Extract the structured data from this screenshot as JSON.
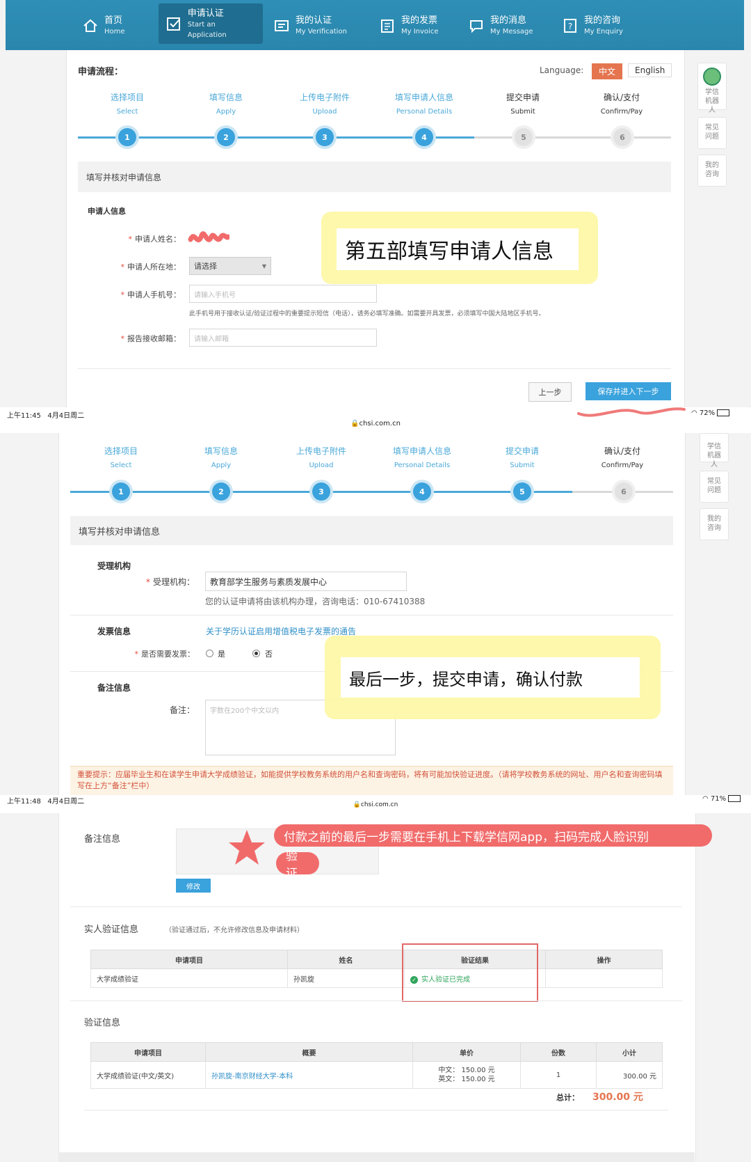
{
  "nav": [
    {
      "zh": "首页",
      "en": "Home",
      "icon": "home-icon"
    },
    {
      "zh": "申请认证",
      "en": "Start an Application",
      "icon": "checkbox-icon",
      "active": true
    },
    {
      "zh": "我的认证",
      "en": "My Verification",
      "icon": "verification-icon"
    },
    {
      "zh": "我的发票",
      "en": "My Invoice",
      "icon": "invoice-icon"
    },
    {
      "zh": "我的消息",
      "en": "My Message",
      "icon": "message-icon"
    },
    {
      "zh": "我的咨询",
      "en": "My Enquiry",
      "icon": "enquiry-icon"
    }
  ],
  "process": {
    "title": "申请流程：",
    "language_label": "Language:",
    "lang_zh": "中文",
    "lang_en": "English"
  },
  "steps": [
    {
      "zh": "选择项目",
      "en": "Select",
      "n": "1"
    },
    {
      "zh": "填写信息",
      "en": "Apply",
      "n": "2"
    },
    {
      "zh": "上传电子附件",
      "en": "Upload",
      "n": "3"
    },
    {
      "zh": "填写申请人信息",
      "en": "Personal Details",
      "n": "4"
    },
    {
      "zh": "提交申请",
      "en": "Submit",
      "n": "5"
    },
    {
      "zh": "确认/支付",
      "en": "Confirm/Pay",
      "n": "6"
    }
  ],
  "side": {
    "robot": "学信机器人",
    "faq": "常见问题",
    "enquiry": "我的咨询"
  },
  "panel1": {
    "section": "填写并核对申请信息",
    "applicant_title": "申请人信息",
    "name_label": "申请人姓名：",
    "location_label": "申请人所在地：",
    "location_value": "请选择",
    "phone_label": "申请人手机号：",
    "phone_placeholder": "请输入手机号",
    "phone_hint": "此手机号用于接收认证/验证过程中的重要提示短信（电话），请务必填写准确。如需要开具发票，必须填写中国大陆地区手机号。",
    "email_label": "报告接收邮箱：",
    "email_placeholder": "请输入邮箱",
    "prev_button": "上一步",
    "next_button": "保存并进入下一步",
    "note": "第五部填写申请人信息"
  },
  "status1": {
    "time": "上午11:45",
    "date": "4月4日周二",
    "url": "chsi.com.cn",
    "battery": "72%"
  },
  "panel2": {
    "section": "填写并核对申请信息",
    "agency_title": "受理机构",
    "agency_label": "受理机构：",
    "agency_value": "教育部学生服务与素质发展中心",
    "agency_hint": "您的认证申请将由该机构办理，咨询电话：010-67410388",
    "invoice_title": "发票信息",
    "invoice_link": "关于学历认证启用增值税电子发票的通告",
    "invoice_label": "是否需要发票：",
    "yes": "是",
    "no": "否",
    "remark_title": "备注信息",
    "remark_label": "备注：",
    "remark_placeholder": "字数在200个中文以内",
    "tip": "重要提示：应届毕业生和在读学生申请大学成绩验证，如能提供学校教务系统的用户名和查询密码，将有可能加快验证进度。（请将学校教务系统的网址、用户名和查询密码填写在上方“备注”栏中）",
    "note": "最后一步，提交申请，确认付款"
  },
  "status2": {
    "time": "上午11:48",
    "date": "4月4日周二",
    "url": "chsi.com.cn",
    "battery": "71%"
  },
  "panel3": {
    "remark_title": "备注信息",
    "modify_button": "修改",
    "note_line1": "付款之前的最后一步需要在手机上下载学信网app，扫码完成人脸识别",
    "note_line2": "验证。",
    "realname_title": "实人验证信息",
    "realname_hint": "（验证通过后，不允许修改信息及申请材料）",
    "realname_headers": [
      "申请项目",
      "姓名",
      "验证结果",
      "操作"
    ],
    "realname_row": {
      "item": "大学成绩验证",
      "name": "孙凯旋",
      "result": "实人验证已完成",
      "action": ""
    },
    "verify_title": "验证信息",
    "verify_headers": [
      "申请项目",
      "概要",
      "单价",
      "份数",
      "小计"
    ],
    "verify_row": {
      "item": "大学成绩验证(中文/英文)",
      "summary": "孙凯旋-南京财经大学-本科",
      "price_zh": "中文： 150.00 元",
      "price_en": "英文： 150.00 元",
      "qty": "1",
      "subtotal": "300.00 元"
    },
    "total_label": "总计：",
    "total_value": "300.00 元"
  },
  "colors": {
    "nav": "#2f8fb6",
    "accent": "#3aa2dc",
    "lang_active": "#e4754f",
    "note_pink": "#f16b6b",
    "note_yellow": "#fdf8a8"
  }
}
